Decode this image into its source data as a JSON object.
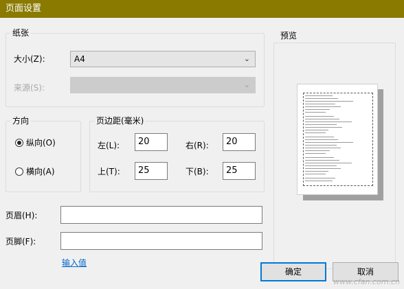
{
  "window": {
    "title": "页面设置"
  },
  "paper": {
    "group_title": "纸张",
    "size_label": "大小(Z):",
    "size_value": "A4",
    "source_label": "来源(S):",
    "source_value": ""
  },
  "orientation": {
    "group_title": "方向",
    "portrait_label": "纵向(O)",
    "landscape_label": "横向(A)",
    "selected": "portrait"
  },
  "margins": {
    "group_title": "页边距(毫米)",
    "left_label": "左(L):",
    "left_value": "20",
    "right_label": "右(R):",
    "right_value": "20",
    "top_label": "上(T):",
    "top_value": "25",
    "bottom_label": "下(B):",
    "bottom_value": "25"
  },
  "header": {
    "label": "页眉(H):",
    "value": ""
  },
  "footer": {
    "label": "页脚(F):",
    "value": ""
  },
  "input_values_link": "输入值",
  "preview": {
    "group_title": "预览"
  },
  "buttons": {
    "ok": "确定",
    "cancel": "取消"
  },
  "watermark": "www.cfan.com.cn",
  "colors": {
    "titlebar": "#8a7a00",
    "link": "#0066cc",
    "default_button_border": "#0078d7"
  }
}
